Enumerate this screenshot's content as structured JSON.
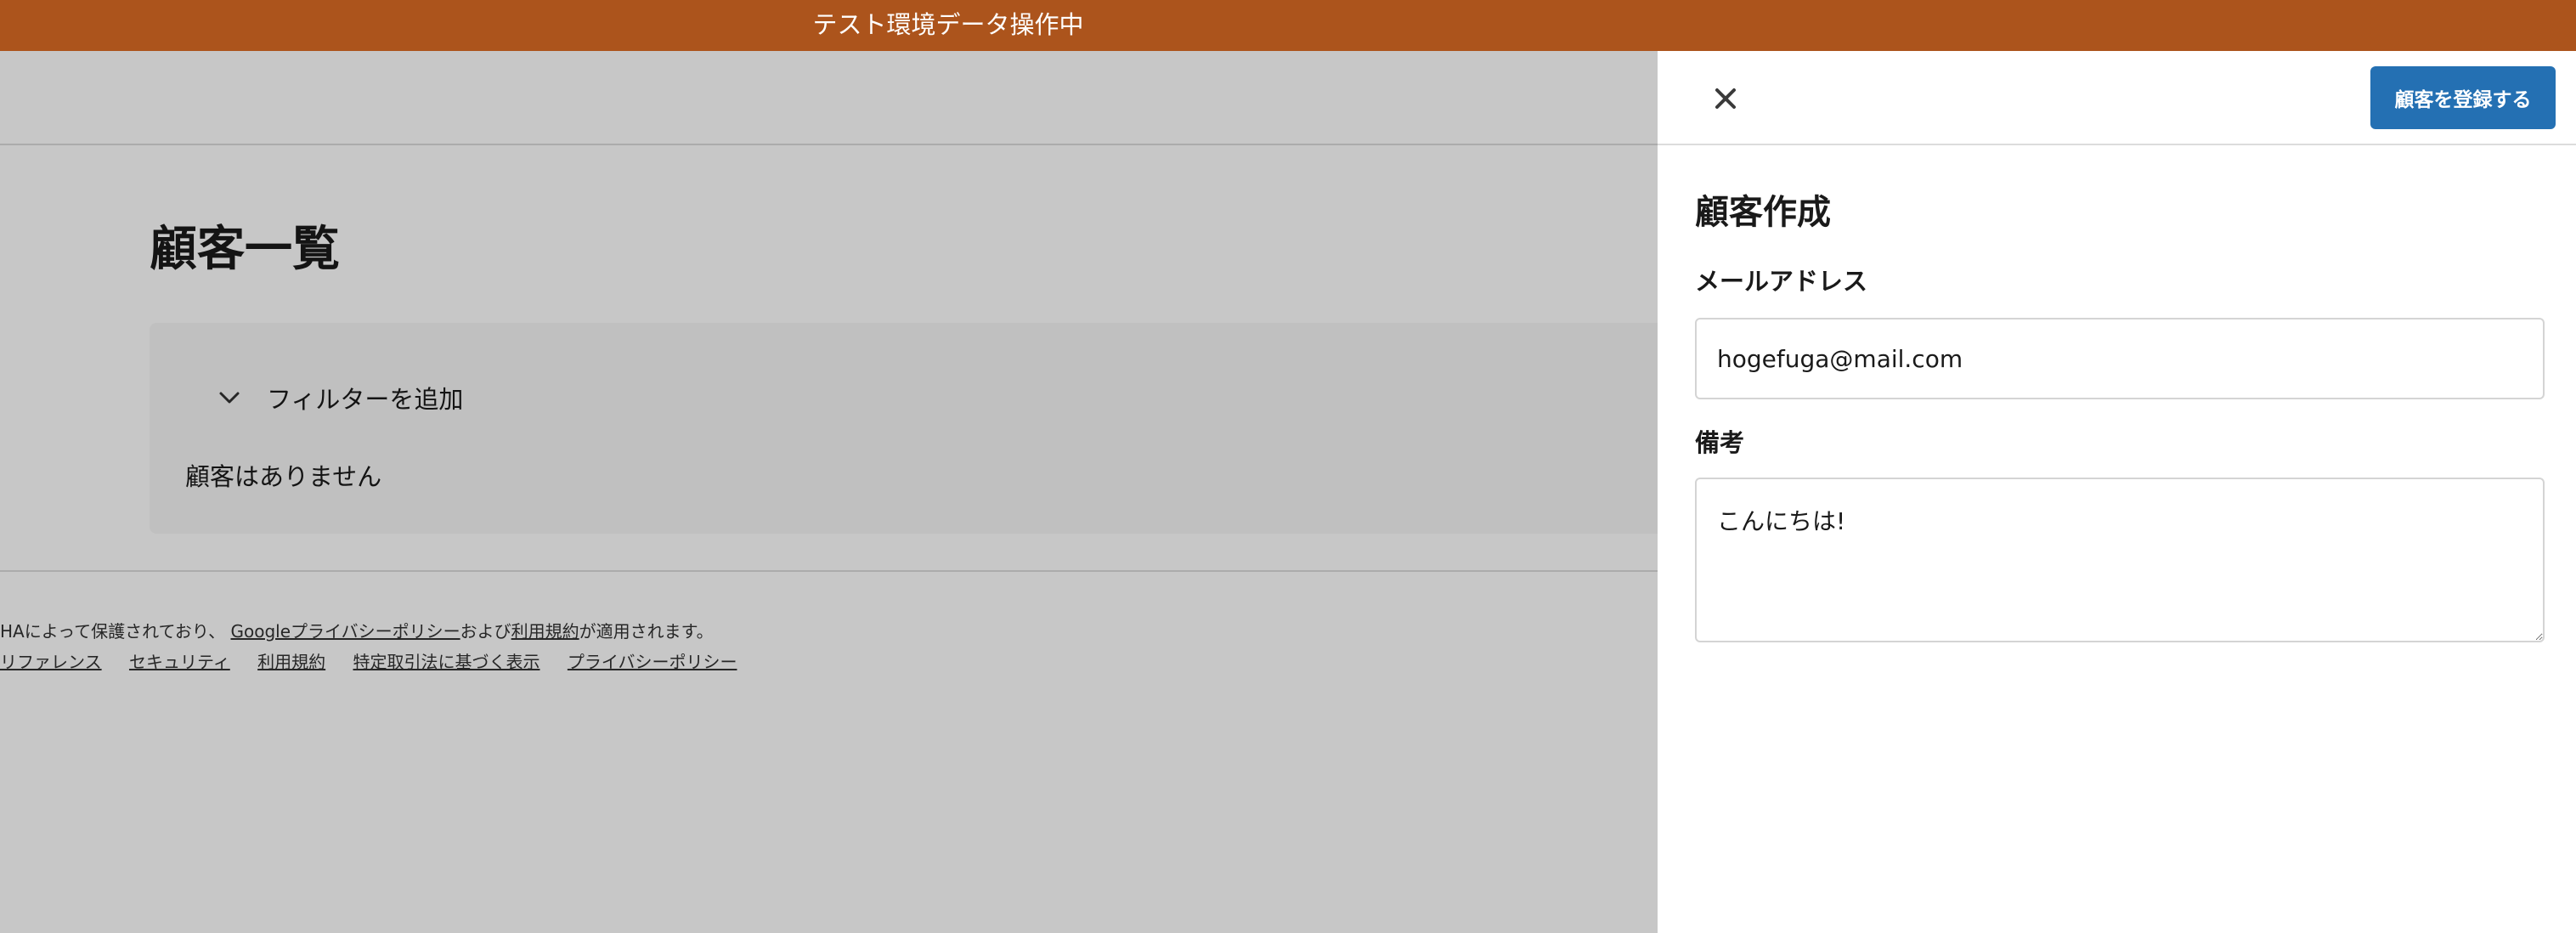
{
  "banner": {
    "text": "テスト環境データ操作中"
  },
  "page": {
    "title": "顧客一覧",
    "filter_label": "フィルターを追加",
    "empty_text": "顧客はありません",
    "footer": {
      "notice_prefix": "HAによって保護されており、",
      "notice_link_privacy": "Googleプライバシーポリシー",
      "notice_and": "および",
      "notice_link_terms": "利用規約",
      "notice_suffix": "が適用されます。",
      "links": [
        "リファレンス",
        "セキュリティ",
        "利用規約",
        "特定取引法に基づく表示",
        "プライバシーポリシー"
      ]
    }
  },
  "drawer": {
    "close_icon": "close-icon",
    "submit_label": "顧客を登録する",
    "title": "顧客作成",
    "email_label": "メールアドレス",
    "email_value": "hogefuga@mail.com",
    "note_label": "備考",
    "note_value": "こんにちは!"
  },
  "colors": {
    "banner": "#ac541c",
    "primary_button": "#2470b3",
    "overlay": "rgba(0,0,0,0.22)"
  }
}
